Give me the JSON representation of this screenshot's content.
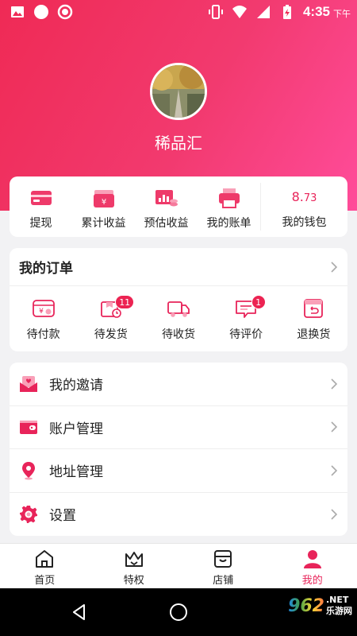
{
  "status_bar": {
    "time": "4:35",
    "ampm": "下午"
  },
  "profile": {
    "name": "稀品汇"
  },
  "wallet": {
    "items": [
      {
        "label": "提现",
        "icon": "withdraw-icon"
      },
      {
        "label": "累计收益",
        "icon": "total-income-icon"
      },
      {
        "label": "预估收益",
        "icon": "estimated-income-icon"
      },
      {
        "label": "我的账单",
        "icon": "bill-icon"
      }
    ],
    "balance_int": "8.",
    "balance_dec": "73",
    "balance_label": "我的钱包"
  },
  "orders": {
    "title": "我的订单",
    "items": [
      {
        "label": "待付款",
        "icon": "pending-payment-icon",
        "badge": ""
      },
      {
        "label": "待发货",
        "icon": "pending-shipment-icon",
        "badge": "11"
      },
      {
        "label": "待收货",
        "icon": "pending-receipt-icon",
        "badge": ""
      },
      {
        "label": "待评价",
        "icon": "pending-review-icon",
        "badge": "1"
      },
      {
        "label": "退换货",
        "icon": "returns-icon",
        "badge": ""
      }
    ]
  },
  "menu": {
    "items": [
      {
        "label": "我的邀请",
        "icon": "invite-icon"
      },
      {
        "label": "账户管理",
        "icon": "account-icon"
      },
      {
        "label": "地址管理",
        "icon": "location-icon"
      },
      {
        "label": "设置",
        "icon": "settings-icon"
      }
    ]
  },
  "tabbar": {
    "items": [
      {
        "label": "首页",
        "icon": "home-icon"
      },
      {
        "label": "特权",
        "icon": "crown-icon"
      },
      {
        "label": "店铺",
        "icon": "store-icon"
      },
      {
        "label": "我的",
        "icon": "profile-icon"
      }
    ],
    "active_index": 3
  },
  "watermark": {
    "logo": "962",
    "line1": ".NET",
    "line2": "乐游网"
  },
  "colors": {
    "accent": "#e8245a",
    "header_start": "#ef2a55",
    "header_end": "#ff4c9a"
  }
}
